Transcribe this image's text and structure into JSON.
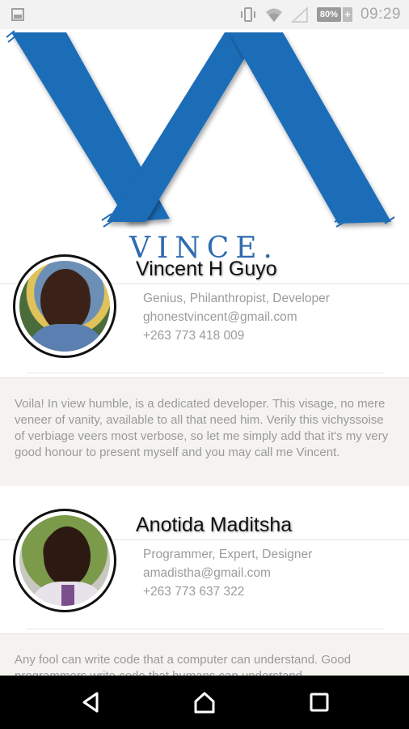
{
  "status_bar": {
    "battery_percent": "80%",
    "time": "09:29",
    "icons": [
      "image-icon",
      "vibrate-icon",
      "wifi-icon",
      "signal-icon",
      "battery-icon",
      "charging-icon"
    ]
  },
  "logo": {
    "text": "VINCE.",
    "accent_color": "#1f6db8"
  },
  "profiles": [
    {
      "name": "Vincent H Guyo",
      "title": "Genius, Philanthropist, Developer",
      "email": "ghonestvincent@gmail.com",
      "phone": "+263 773 418 009",
      "bio": "Voila! In view humble, is a dedicated developer. This visage,  no mere veneer of vanity, available to all that need him. Verily this vichyssoise of verbiage veers most verbose, so let me simply add that it's my very good honour to present myself and you may call me Vincent."
    },
    {
      "name": "Anotida Maditsha",
      "title": "Programmer, Expert, Designer",
      "email": "amadistha@gmail.com",
      "phone": "+263 773 637 322",
      "bio": "Any fool can write code that a computer can understand. Good programmers write code that humans can understand."
    }
  ],
  "nav_bar": {
    "icons": [
      "back-icon",
      "home-icon",
      "recents-icon"
    ]
  }
}
